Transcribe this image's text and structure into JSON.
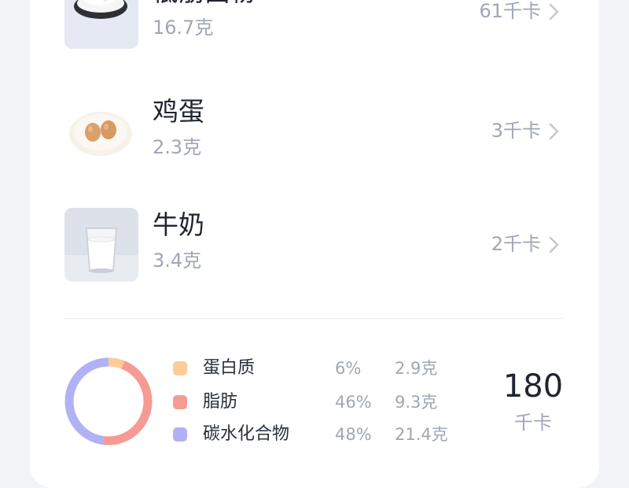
{
  "foods": [
    {
      "name": "低筋面粉",
      "weight": "16.7克",
      "calories": "61千卡",
      "icon": "flour-bowl-icon"
    },
    {
      "name": "鸡蛋",
      "weight": "2.3克",
      "calories": "3千卡",
      "icon": "eggs-plate-icon"
    },
    {
      "name": "牛奶",
      "weight": "3.4克",
      "calories": "2千卡",
      "icon": "milk-glass-icon"
    }
  ],
  "nutrition": {
    "macros": [
      {
        "name": "蛋白质",
        "percent": "6%",
        "grams": "2.9克",
        "color": "#fccb96"
      },
      {
        "name": "脂肪",
        "percent": "46%",
        "grams": "9.3克",
        "color": "#f59b94"
      },
      {
        "name": "碳水化合物",
        "percent": "48%",
        "grams": "21.4克",
        "color": "#b1b1f6"
      }
    ],
    "total_value": "180",
    "total_unit": "千卡"
  }
}
